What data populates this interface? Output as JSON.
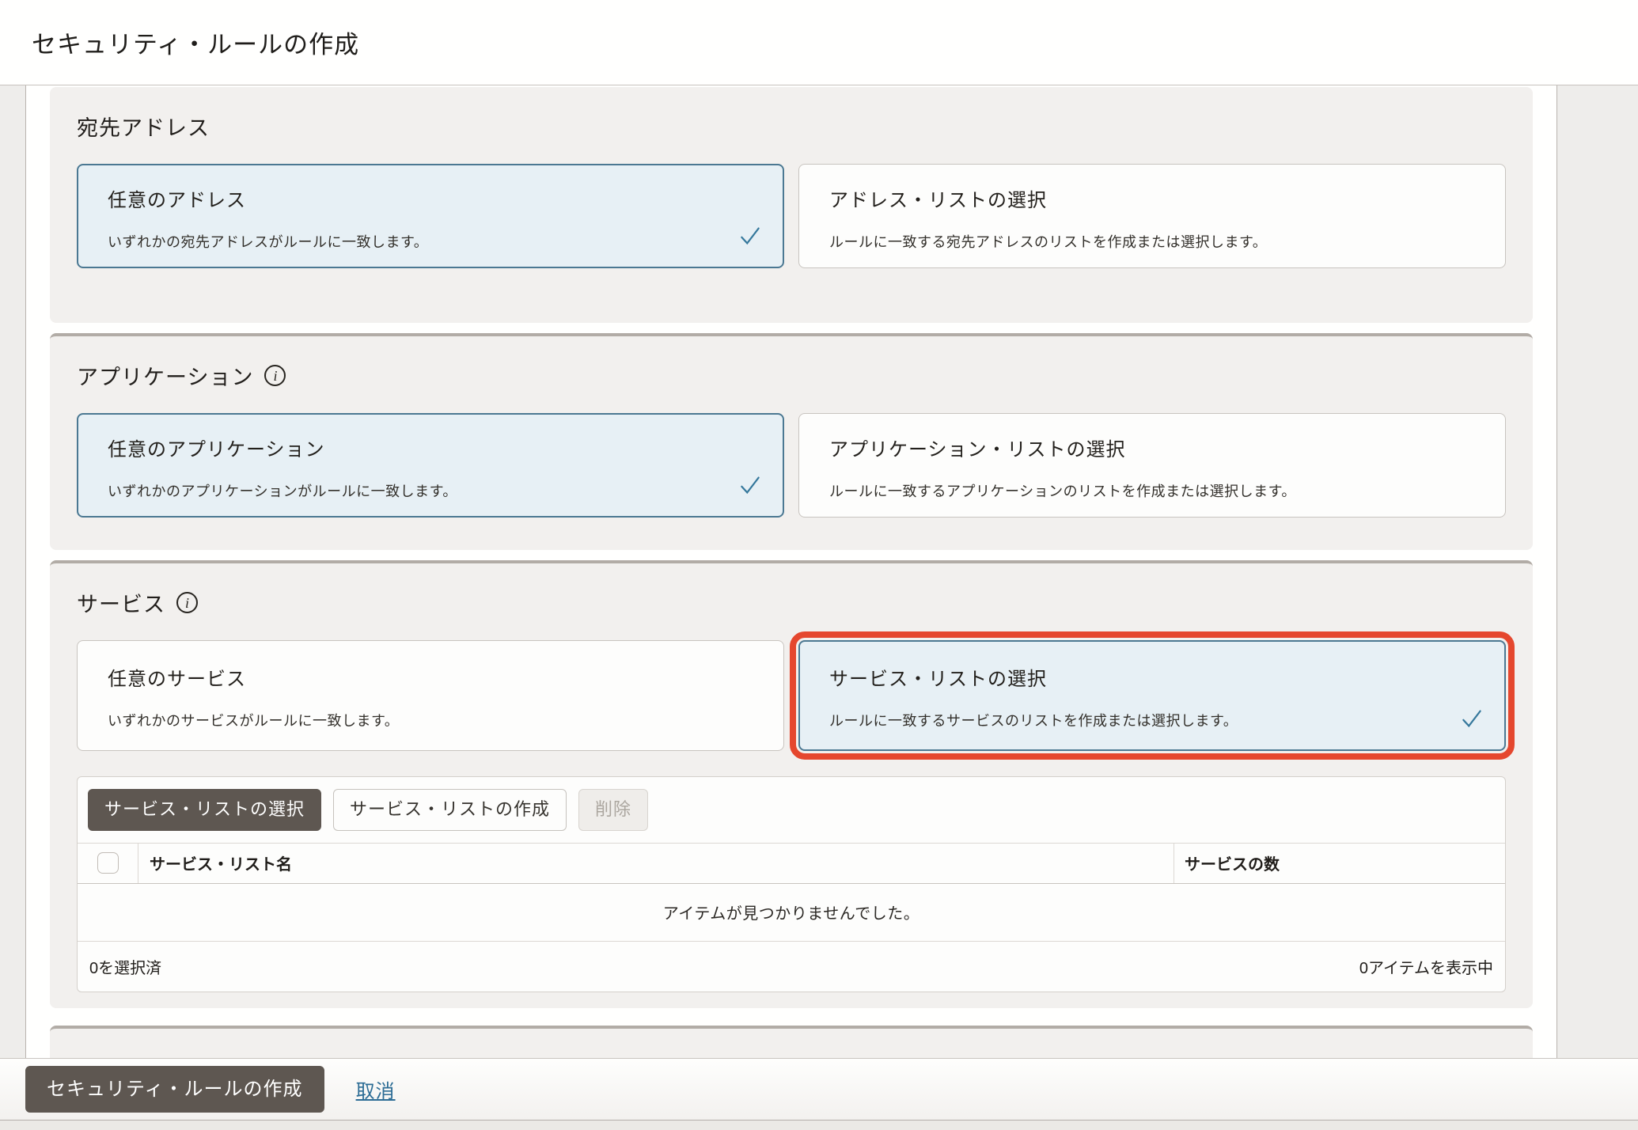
{
  "header": {
    "title": "セキュリティ・ルールの作成"
  },
  "sections": [
    {
      "heading": "宛先アドレス",
      "has_info_icon": false,
      "cards": [
        {
          "title": "任意のアドレス",
          "description": "いずれかの宛先アドレスがルールに一致します。",
          "selected": true
        },
        {
          "title": "アドレス・リストの選択",
          "description": "ルールに一致する宛先アドレスのリストを作成または選択します。",
          "selected": false
        }
      ]
    },
    {
      "heading": "アプリケーション",
      "has_info_icon": true,
      "cards": [
        {
          "title": "任意のアプリケーション",
          "description": "いずれかのアプリケーションがルールに一致します。",
          "selected": true
        },
        {
          "title": "アプリケーション・リストの選択",
          "description": "ルールに一致するアプリケーションのリストを作成または選択します。",
          "selected": false
        }
      ]
    },
    {
      "heading": "サービス",
      "has_info_icon": true,
      "cards": [
        {
          "title": "任意のサービス",
          "description": "いずれかのサービスがルールに一致します。",
          "selected": false
        },
        {
          "title": "サービス・リストの選択",
          "description": "ルールに一致するサービスのリストを作成または選択します。",
          "selected": true,
          "highlighted": true
        }
      ],
      "list_panel": {
        "buttons": [
          {
            "label": "サービス・リストの選択",
            "style": "primary"
          },
          {
            "label": "サービス・リストの作成",
            "style": "secondary"
          },
          {
            "label": "削除",
            "style": "disabled"
          }
        ],
        "columns": [
          "サービス・リスト名",
          "サービスの数"
        ],
        "empty_message": "アイテムが見つかりませんでした。",
        "selected_count_label": "0を選択済",
        "items_shown_label": "0アイテムを表示中"
      }
    }
  ],
  "footer": {
    "create_label": "セキュリティ・ルールの作成",
    "cancel_label": "取消"
  },
  "icons": {
    "info": "i",
    "check": "check-mark"
  },
  "colors": {
    "selected_card_bg": "#e7f0f5",
    "selected_card_border": "#4b7892",
    "check_mark": "#35789c",
    "highlight_ring": "#e5472e",
    "primary_button_bg": "#5e5751",
    "link_blue": "#2c6c95",
    "panel_bg": "#f2f0ee",
    "panel_top_border": "#b2aca6"
  }
}
